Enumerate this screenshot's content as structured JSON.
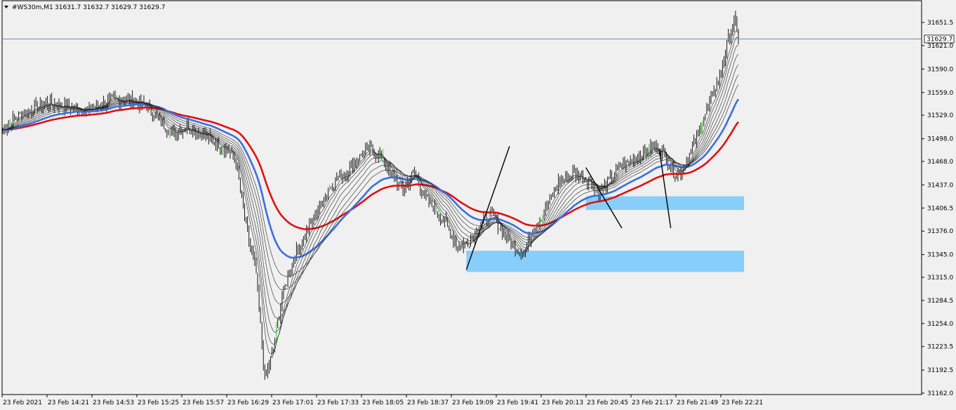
{
  "header": {
    "symbol": "#WS30m,M1",
    "ohlc": "31631.7 31632.7 31629.7 31629.7"
  },
  "chart_data": {
    "type": "candlestick",
    "title": "",
    "xlabel": "",
    "ylabel": "",
    "ylim": [
      31162.0,
      31680.0
    ],
    "grid": false,
    "y_ticks": [
      31651.5,
      31621.0,
      31590.0,
      31559.0,
      31529.0,
      31498.0,
      31468.0,
      31437.0,
      31406.5,
      31376.0,
      31345.0,
      31315.0,
      31284.5,
      31254.0,
      31223.5,
      31192.5,
      31162.0
    ],
    "x_ticks": [
      "23 Feb 2021",
      "23 Feb 14:21",
      "23 Feb 14:53",
      "23 Feb 15:25",
      "23 Feb 15:57",
      "23 Feb 16:29",
      "23 Feb 17:01",
      "23 Feb 17:33",
      "23 Feb 18:05",
      "23 Feb 18:37",
      "23 Feb 19:09",
      "23 Feb 19:41",
      "23 Feb 20:13",
      "23 Feb 20:45",
      "23 Feb 21:17",
      "23 Feb 21:49",
      "23 Feb 22:21"
    ],
    "current_price": 31629.7,
    "current_price_label": "31629.7",
    "bar_count": 512,
    "price_keys": [
      [
        0,
        31510
      ],
      [
        12,
        31530
      ],
      [
        30,
        31545
      ],
      [
        45,
        31540
      ],
      [
        60,
        31535
      ],
      [
        75,
        31550
      ],
      [
        90,
        31548
      ],
      [
        100,
        31540
      ],
      [
        110,
        31520
      ],
      [
        118,
        31505
      ],
      [
        128,
        31515
      ],
      [
        142,
        31500
      ],
      [
        155,
        31485
      ],
      [
        162,
        31470
      ],
      [
        168,
        31390
      ],
      [
        176,
        31320
      ],
      [
        182,
        31180
      ],
      [
        188,
        31220
      ],
      [
        194,
        31290
      ],
      [
        202,
        31340
      ],
      [
        210,
        31370
      ],
      [
        218,
        31400
      ],
      [
        226,
        31430
      ],
      [
        234,
        31450
      ],
      [
        240,
        31455
      ],
      [
        246,
        31470
      ],
      [
        254,
        31485
      ],
      [
        262,
        31475
      ],
      [
        270,
        31450
      ],
      [
        278,
        31430
      ],
      [
        286,
        31455
      ],
      [
        292,
        31425
      ],
      [
        300,
        31405
      ],
      [
        308,
        31385
      ],
      [
        316,
        31355
      ],
      [
        324,
        31362
      ],
      [
        332,
        31385
      ],
      [
        340,
        31400
      ],
      [
        348,
        31370
      ],
      [
        356,
        31355
      ],
      [
        362,
        31345
      ],
      [
        368,
        31380
      ],
      [
        376,
        31400
      ],
      [
        386,
        31440
      ],
      [
        396,
        31452
      ],
      [
        406,
        31445
      ],
      [
        414,
        31428
      ],
      [
        420,
        31438
      ],
      [
        428,
        31460
      ],
      [
        440,
        31472
      ],
      [
        452,
        31488
      ],
      [
        460,
        31478
      ],
      [
        465,
        31455
      ],
      [
        470,
        31452
      ],
      [
        478,
        31480
      ],
      [
        488,
        31530
      ],
      [
        498,
        31580
      ],
      [
        504,
        31630
      ],
      [
        508,
        31655
      ],
      [
        511,
        31630
      ]
    ],
    "series": [
      {
        "name": "",
        "kind": "ema",
        "period": 90,
        "color": "#e01010",
        "width": 2.6
      },
      {
        "name": "",
        "kind": "ema",
        "period": 55,
        "color": "#3b6fe0",
        "width": 2.6
      },
      {
        "name": "",
        "kind": "ema",
        "period": 40,
        "color": "#222222",
        "width": 0.6
      },
      {
        "name": "",
        "kind": "ema",
        "period": 32,
        "color": "#222222",
        "width": 0.6
      },
      {
        "name": "",
        "kind": "ema",
        "period": 25,
        "color": "#222222",
        "width": 0.6
      },
      {
        "name": "",
        "kind": "ema",
        "period": 19,
        "color": "#222222",
        "width": 0.6
      },
      {
        "name": "",
        "kind": "ema",
        "period": 14,
        "color": "#222222",
        "width": 0.6
      },
      {
        "name": "",
        "kind": "ema",
        "period": 10,
        "color": "#222222",
        "width": 0.6
      },
      {
        "name": "",
        "kind": "ema",
        "period": 7,
        "color": "#222222",
        "width": 0.6
      }
    ],
    "zones": [
      {
        "from_bar": 405,
        "to_bar": 511,
        "y1": 31422.0,
        "y2": 31404.0,
        "color": "#87cefa"
      },
      {
        "from_bar": 322,
        "to_bar": 511,
        "y1": 31350.0,
        "y2": 31322.0,
        "color": "#87cefa"
      }
    ],
    "trendlines": [
      {
        "bar1": 322,
        "y1": 31325.0,
        "bar2": 352,
        "y2": 31488.0,
        "color": "#000000"
      },
      {
        "bar1": 405,
        "y1": 31460.0,
        "bar2": 430,
        "y2": 31380.0,
        "color": "#000000"
      },
      {
        "bar1": 456,
        "y1": 31485.0,
        "bar2": 464,
        "y2": 31380.0,
        "color": "#000000"
      }
    ]
  }
}
